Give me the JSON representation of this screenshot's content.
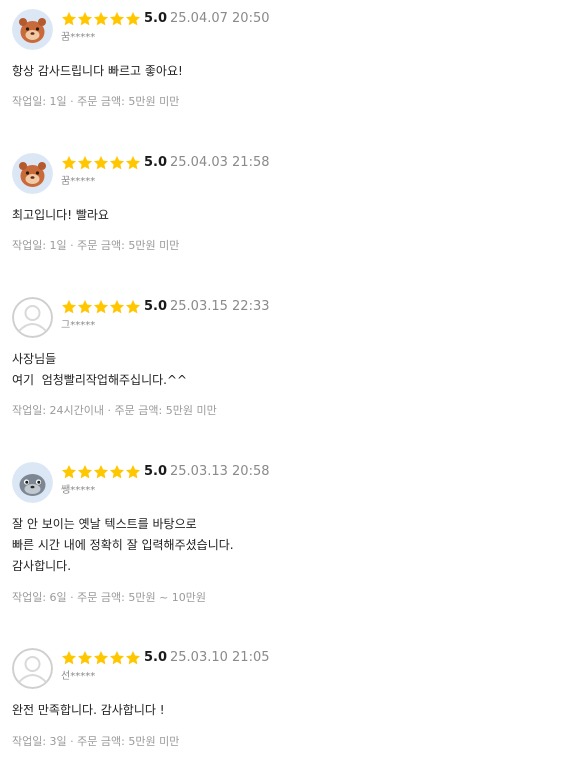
{
  "reviews": [
    {
      "avatar_icon": "bear-character-avatar-icon",
      "rating": "5.0",
      "date": "25.04.07 20:50",
      "username": "꿈*****",
      "text": "항상 감사드립니다 빠르고 좋아요!",
      "meta": "작업일: 1일 · 주문 금액: 5만원 미만"
    },
    {
      "avatar_icon": "bear-character-avatar-icon",
      "rating": "5.0",
      "date": "25.04.03 21:58",
      "username": "꿈*****",
      "text": "최고입니다! 빨라요",
      "meta": "작업일: 1일 · 주문 금액: 5만원 미만"
    },
    {
      "avatar_icon": "default-user-avatar-icon",
      "rating": "5.0",
      "date": "25.03.15 22:33",
      "username": "그*****",
      "text": "사장님들\n여기  엄청빨리작업해주십니다.^^",
      "meta": "작업일: 24시간이내 · 주문 금액: 5만원 미만"
    },
    {
      "avatar_icon": "seal-character-avatar-icon",
      "rating": "5.0",
      "date": "25.03.13 20:58",
      "username": "쌩*****",
      "text": "잘 안 보이는 옛날 텍스트를 바탕으로\n빠른 시간 내에 정확히 잘 입력해주셨습니다.\n감사합니다.",
      "meta": "작업일: 6일 · 주문 금액: 5만원 ~ 10만원"
    },
    {
      "avatar_icon": "default-user-avatar-icon",
      "rating": "5.0",
      "date": "25.03.10 21:05",
      "username": "선*****",
      "text": "완전 만족합니다. 감사합니다 !",
      "meta": "작업일: 3일 · 주문 금액: 5만원 미만"
    }
  ],
  "colors": {
    "star": "#FFC700",
    "muted_text": "#8a8a8a",
    "body_text": "#222222"
  }
}
